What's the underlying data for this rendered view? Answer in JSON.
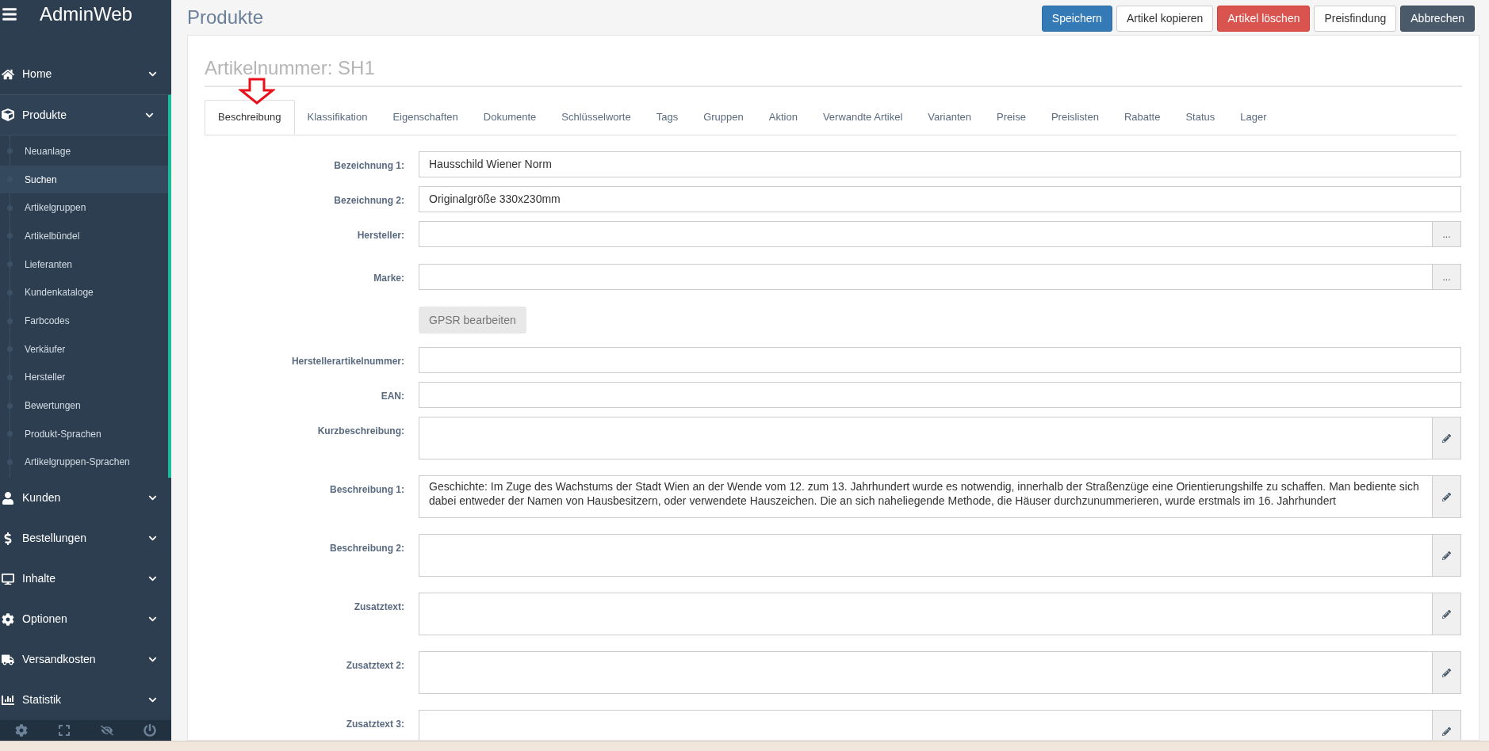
{
  "app": {
    "title": "AdminWeb"
  },
  "sidebar": {
    "items": [
      {
        "label": "Home",
        "expanded": false
      },
      {
        "label": "Produkte",
        "expanded": true,
        "children": [
          {
            "label": "Neuanlage",
            "selected": false
          },
          {
            "label": "Suchen",
            "selected": true
          },
          {
            "label": "Artikelgruppen",
            "selected": false
          },
          {
            "label": "Artikelbündel",
            "selected": false
          },
          {
            "label": "Lieferanten",
            "selected": false
          },
          {
            "label": "Kundenkataloge",
            "selected": false
          },
          {
            "label": "Farbcodes",
            "selected": false
          },
          {
            "label": "Verkäufer",
            "selected": false
          },
          {
            "label": "Hersteller",
            "selected": false
          },
          {
            "label": "Bewertungen",
            "selected": false
          },
          {
            "label": "Produkt-Sprachen",
            "selected": false
          },
          {
            "label": "Artikelgruppen-Sprachen",
            "selected": false
          }
        ]
      },
      {
        "label": "Kunden",
        "expanded": false
      },
      {
        "label": "Bestellungen",
        "expanded": false
      },
      {
        "label": "Inhalte",
        "expanded": false
      },
      {
        "label": "Optionen",
        "expanded": false
      },
      {
        "label": "Versandkosten",
        "expanded": false
      },
      {
        "label": "Statistik",
        "expanded": false
      }
    ]
  },
  "page": {
    "title": "Produkte"
  },
  "actions": [
    {
      "label": "Speichern",
      "kind": "primary"
    },
    {
      "label": "Artikel kopieren",
      "kind": "default"
    },
    {
      "label": "Artikel löschen",
      "kind": "danger"
    },
    {
      "label": "Preisfindung",
      "kind": "default"
    },
    {
      "label": "Abbrechen",
      "kind": "dark"
    }
  ],
  "card": {
    "title": "Artikelnummer: SH1"
  },
  "tabs": [
    {
      "label": "Beschreibung",
      "selected": true
    },
    {
      "label": "Klassifikation",
      "selected": false
    },
    {
      "label": "Eigenschaften",
      "selected": false
    },
    {
      "label": "Dokumente",
      "selected": false
    },
    {
      "label": "Schlüsselworte",
      "selected": false
    },
    {
      "label": "Tags",
      "selected": false
    },
    {
      "label": "Gruppen",
      "selected": false
    },
    {
      "label": "Aktion",
      "selected": false
    },
    {
      "label": "Verwandte Artikel",
      "selected": false
    },
    {
      "label": "Varianten",
      "selected": false
    },
    {
      "label": "Preise",
      "selected": false
    },
    {
      "label": "Preislisten",
      "selected": false
    },
    {
      "label": "Rabatte",
      "selected": false
    },
    {
      "label": "Status",
      "selected": false
    },
    {
      "label": "Lager",
      "selected": false
    }
  ],
  "form": [
    {
      "kind": "text",
      "label": "Bezeichnung 1:",
      "value": "Hausschild Wiener Norm"
    },
    {
      "kind": "text",
      "label": "Bezeichnung 2:",
      "value": "Originalgröße 330x230mm"
    },
    {
      "kind": "lookup",
      "label": "Hersteller:",
      "button": "..."
    },
    {
      "kind": "lookup",
      "label": "Marke:",
      "button": "..."
    },
    {
      "kind": "button",
      "button": "GPSR bearbeiten"
    },
    {
      "kind": "text",
      "label": "Herstellerartikelnummer:"
    },
    {
      "kind": "text",
      "label": "EAN:"
    },
    {
      "kind": "textarea",
      "label": "Kurzbeschreibung:"
    },
    {
      "kind": "textarea",
      "label": "Beschreibung 1:",
      "value": "Geschichte: Im Zuge des Wachstums der Stadt Wien an der Wende vom 12. zum 13. Jahrhundert wurde es notwendig, innerhalb der Straßenzüge eine Orientierungshilfe zu schaffen. Man bediente sich dabei entweder der Namen von Hausbesitzern, oder verwendete Hauszeichen. Die an sich naheliegende Methode, die Häuser durchzunummerieren, wurde erstmals im 16. Jahrhundert"
    },
    {
      "kind": "textarea",
      "label": "Beschreibung 2:"
    },
    {
      "kind": "textarea",
      "label": "Zusatztext:"
    },
    {
      "kind": "textarea",
      "label": "Zusatztext 2:"
    },
    {
      "kind": "textarea",
      "label": "Zusatztext 3:"
    }
  ]
}
